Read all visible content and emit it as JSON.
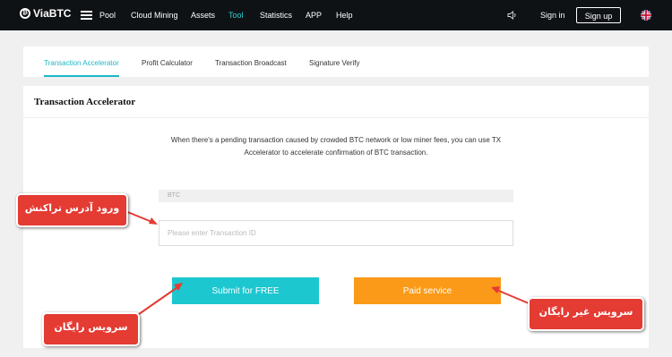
{
  "nav": {
    "logo": "ViaBTC",
    "links": [
      "Pool",
      "Cloud Mining",
      "Assets",
      "Tool",
      "Statistics",
      "APP",
      "Help"
    ],
    "active_link": "Tool",
    "sign_in": "Sign in",
    "sign_up": "Sign up"
  },
  "tabs": [
    "Transaction Accelerator",
    "Profit Calculator",
    "Transaction Broadcast",
    "Signature Verify"
  ],
  "card": {
    "title": "Transaction Accelerator",
    "description_line1": "When there's a pending transaction caused by crowded BTC network or low miner fees, you can use TX",
    "description_line2": "Accelerator to accelerate confirmation of BTC transaction.",
    "coin": "BTC",
    "tx_placeholder": "Please enter Transaction ID",
    "submit_free": "Submit for FREE",
    "paid_service": "Paid service"
  },
  "annotations": {
    "enter_address": "ورود آدرس تراکنش",
    "free_service": "سرویس رایگان",
    "paid_service": "سرویس غیر رایگان"
  },
  "colors": {
    "nav_bg": "#0f1215",
    "accent": "#1cc7d0",
    "paid": "#fb9a18",
    "callout": "#e43b33"
  }
}
